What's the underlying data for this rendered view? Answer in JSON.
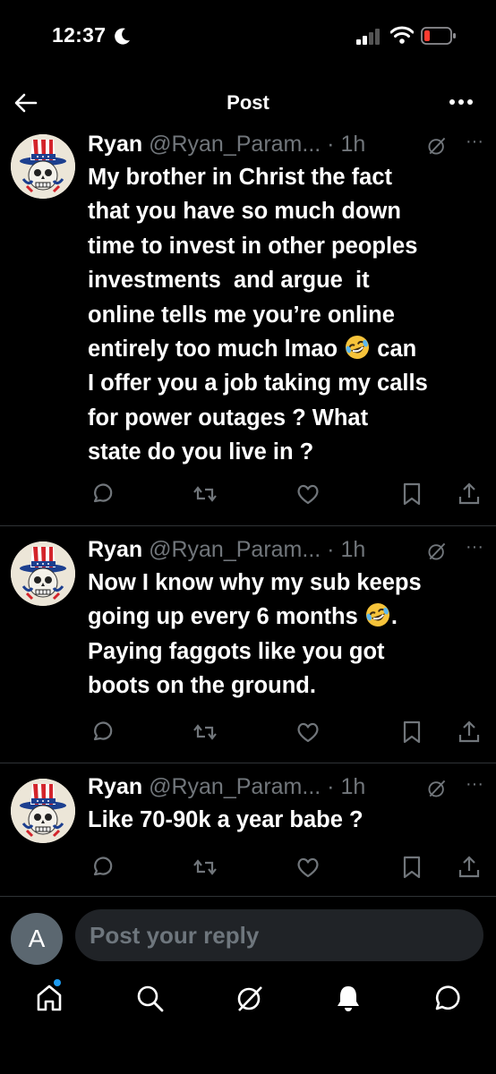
{
  "status_bar": {
    "time": "12:37"
  },
  "nav": {
    "title": "Post"
  },
  "posts": [
    {
      "name": "Ryan",
      "handle": "@Ryan_Param...",
      "time": "1h",
      "text_before_emoji": "My brother in Christ the fact\nthat you have so much down\ntime to invest in other peoples\ninvestments  and argue  it\nonline tells me you’re online\nentirely too much lmao ",
      "text_after_emoji": " can\nI offer you a job taking my calls\nfor power outages ? What\nstate do you live in ?"
    },
    {
      "name": "Ryan",
      "handle": "@Ryan_Param...",
      "time": "1h",
      "text_before_emoji": "Now I know why my sub keeps\ngoing up every 6 months ",
      "text_after_emoji": ".\nPaying faggots like you got\nboots on the ground."
    },
    {
      "name": "Ryan",
      "handle": "@Ryan_Param...",
      "time": "1h",
      "text_before_emoji": "Like 70-90k a year babe ?",
      "text_after_emoji": ""
    }
  ],
  "reply": {
    "avatar_letter": "A",
    "placeholder": "Post your reply"
  },
  "icons": {
    "post_actions": [
      "reply-icon",
      "repost-icon",
      "like-icon",
      "bookmark-icon",
      "share-icon"
    ],
    "tab_bar": [
      "home-icon",
      "search-icon",
      "grok-icon",
      "notifications-icon",
      "messages-icon"
    ]
  },
  "colors": {
    "background": "#000000",
    "text": "#ffffff",
    "secondary": "#71767b",
    "accent": "#1d9bf0",
    "battery_low": "#ff3b30",
    "divider": "#2f3336"
  }
}
